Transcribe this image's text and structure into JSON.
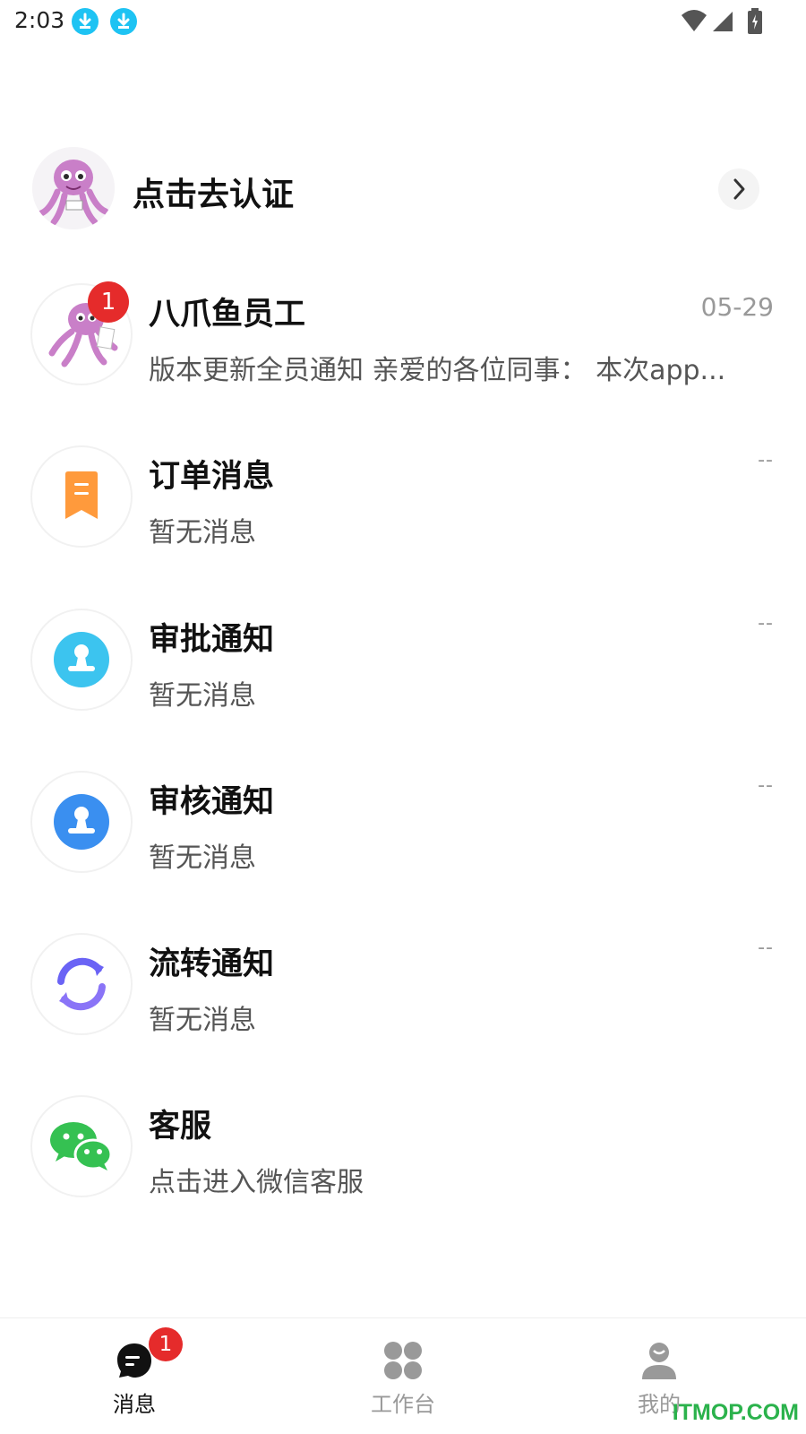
{
  "status_bar": {
    "time": "2:03",
    "icons": [
      "download-icon",
      "download-icon",
      "wifi-icon",
      "signal-icon",
      "battery-icon"
    ]
  },
  "auth": {
    "label": "点击去认证",
    "avatar": "octopus-mascot-avatar",
    "arrow": "chevron-right-icon"
  },
  "messages": [
    {
      "title": "八爪鱼员工",
      "subtitle": "版本更新全员通知 亲爱的各位同事： 本次app...",
      "time": "05-29",
      "badge": "1",
      "icon": "octopus-mascot-avatar"
    },
    {
      "title": "订单消息",
      "subtitle": "暂无消息",
      "time": "--",
      "icon": "order-bookmark-icon",
      "color": "#ff9a3c"
    },
    {
      "title": "审批通知",
      "subtitle": "暂无消息",
      "time": "--",
      "icon": "approval-stamp-icon",
      "color": "#3cc4ef"
    },
    {
      "title": "审核通知",
      "subtitle": "暂无消息",
      "time": "--",
      "icon": "review-stamp-icon",
      "color": "#3a8ff0"
    },
    {
      "title": "流转通知",
      "subtitle": "暂无消息",
      "time": "--",
      "icon": "transfer-refresh-icon",
      "color": "#6a63f5"
    },
    {
      "title": "客服",
      "subtitle": "点击进入微信客服",
      "icon": "wechat-icon",
      "color": "#35c152"
    }
  ],
  "bottom_nav": [
    {
      "label": "消息",
      "icon": "message-icon",
      "badge": "1",
      "active": true
    },
    {
      "label": "工作台",
      "icon": "workbench-grid-icon",
      "active": false
    },
    {
      "label": "我的",
      "icon": "profile-icon",
      "active": false
    }
  ],
  "watermark": "ITMOP.COM",
  "colors": {
    "badge": "#e52b2b",
    "active_nav": "#111111",
    "inactive_nav": "#999999"
  }
}
